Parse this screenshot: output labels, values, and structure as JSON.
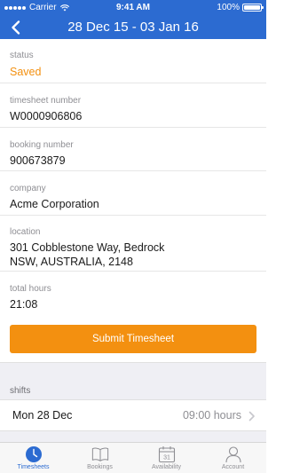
{
  "status_bar": {
    "carrier": "Carrier",
    "time": "9:41 AM",
    "battery": "100%"
  },
  "nav": {
    "title": "28 Dec 15 - 03 Jan 16",
    "back_icon": "chevron-left-icon"
  },
  "fields": {
    "status": {
      "label": "status",
      "value": "Saved"
    },
    "timesheet_number": {
      "label": "timesheet number",
      "value": "W0000906806"
    },
    "booking_number": {
      "label": "booking number",
      "value": "900673879"
    },
    "company": {
      "label": "company",
      "value": "Acme Corporation"
    },
    "location": {
      "label": "location",
      "line1": "301 Cobblestone Way, Bedrock",
      "line2": "NSW, AUSTRALIA, 2148"
    },
    "total_hours": {
      "label": "total hours",
      "value": "21:08"
    }
  },
  "submit_label": "Submit Timesheet",
  "shifts": {
    "header": "shifts",
    "items": [
      {
        "day": "Mon 28 Dec",
        "hours": "09:00 hours"
      }
    ]
  },
  "tabs": [
    {
      "label": "Timesheets",
      "icon": "clock-icon",
      "active": true
    },
    {
      "label": "Bookings",
      "icon": "book-icon",
      "active": false
    },
    {
      "label": "Availability",
      "icon": "calendar-icon",
      "calendar_day": "31",
      "active": false
    },
    {
      "label": "Account",
      "icon": "person-icon",
      "active": false
    }
  ],
  "colors": {
    "primary": "#2c6bd1",
    "accent": "#f39010",
    "secondary_text": "#8e8e93"
  }
}
